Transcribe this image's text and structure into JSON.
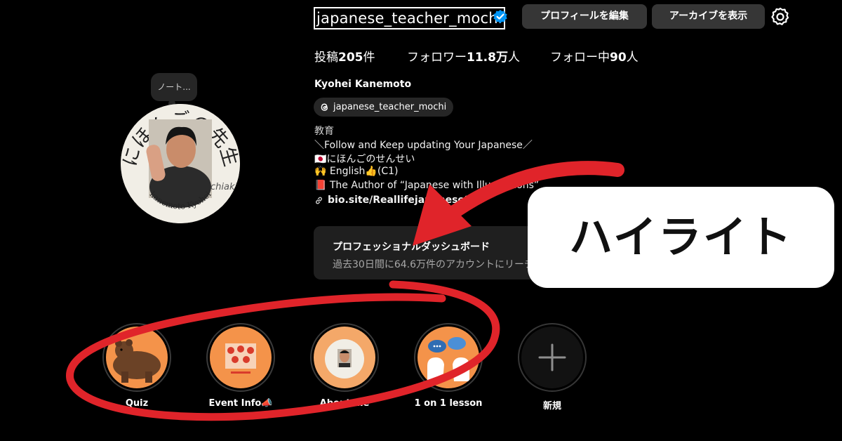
{
  "profile": {
    "username": "japanese_teacher_mochi",
    "edit_button": "プロフィールを編集",
    "archive_button": "アーカイブを表示",
    "stats": [
      {
        "prefix": "投稿",
        "value": "205",
        "suffix": "件"
      },
      {
        "prefix": "フォロワー",
        "value": "11.8万",
        "suffix": "人"
      },
      {
        "prefix": "フォロー中",
        "value": "90",
        "suffix": "人"
      }
    ],
    "display_name": "Kyohei Kanemoto",
    "threads_handle": "japanese_teacher_mochi",
    "category": "教育",
    "bio": [
      "＼Follow and Keep updating Your Japanese／",
      "🇯🇵にほんごのせんせい",
      "🙌 English👍(C1)",
      "📕 The Author of “Japanese with Illustrations”"
    ],
    "link": "bio.site/Reallifejapanese20",
    "note": "ノート...",
    "avatar_text_top": "にほんごの先生",
    "avatar_text_bottom": "kanemoto Kyohei",
    "avatar_signature": "chiaki"
  },
  "dashboard": {
    "title": "プロフェッショナルダッシュボード",
    "subtitle": "過去30日間に64.6万件のアカウントにリーチしました"
  },
  "highlights": [
    {
      "label": "Quiz",
      "color": "#f4934a"
    },
    {
      "label": "Event Info📣",
      "color": "#f4934a"
    },
    {
      "label": "About me",
      "color": "#f4a869"
    },
    {
      "label": "1 on 1 lesson",
      "color": "#f4934a"
    },
    {
      "label": "新規",
      "color": "#000000"
    }
  ],
  "callout": {
    "text": "ハイライト"
  },
  "colors": {
    "background": "#000000",
    "button": "#363636",
    "verified": "#0095f6",
    "annotation_red": "#e0242a",
    "highlight_orange": "#f4934a"
  }
}
